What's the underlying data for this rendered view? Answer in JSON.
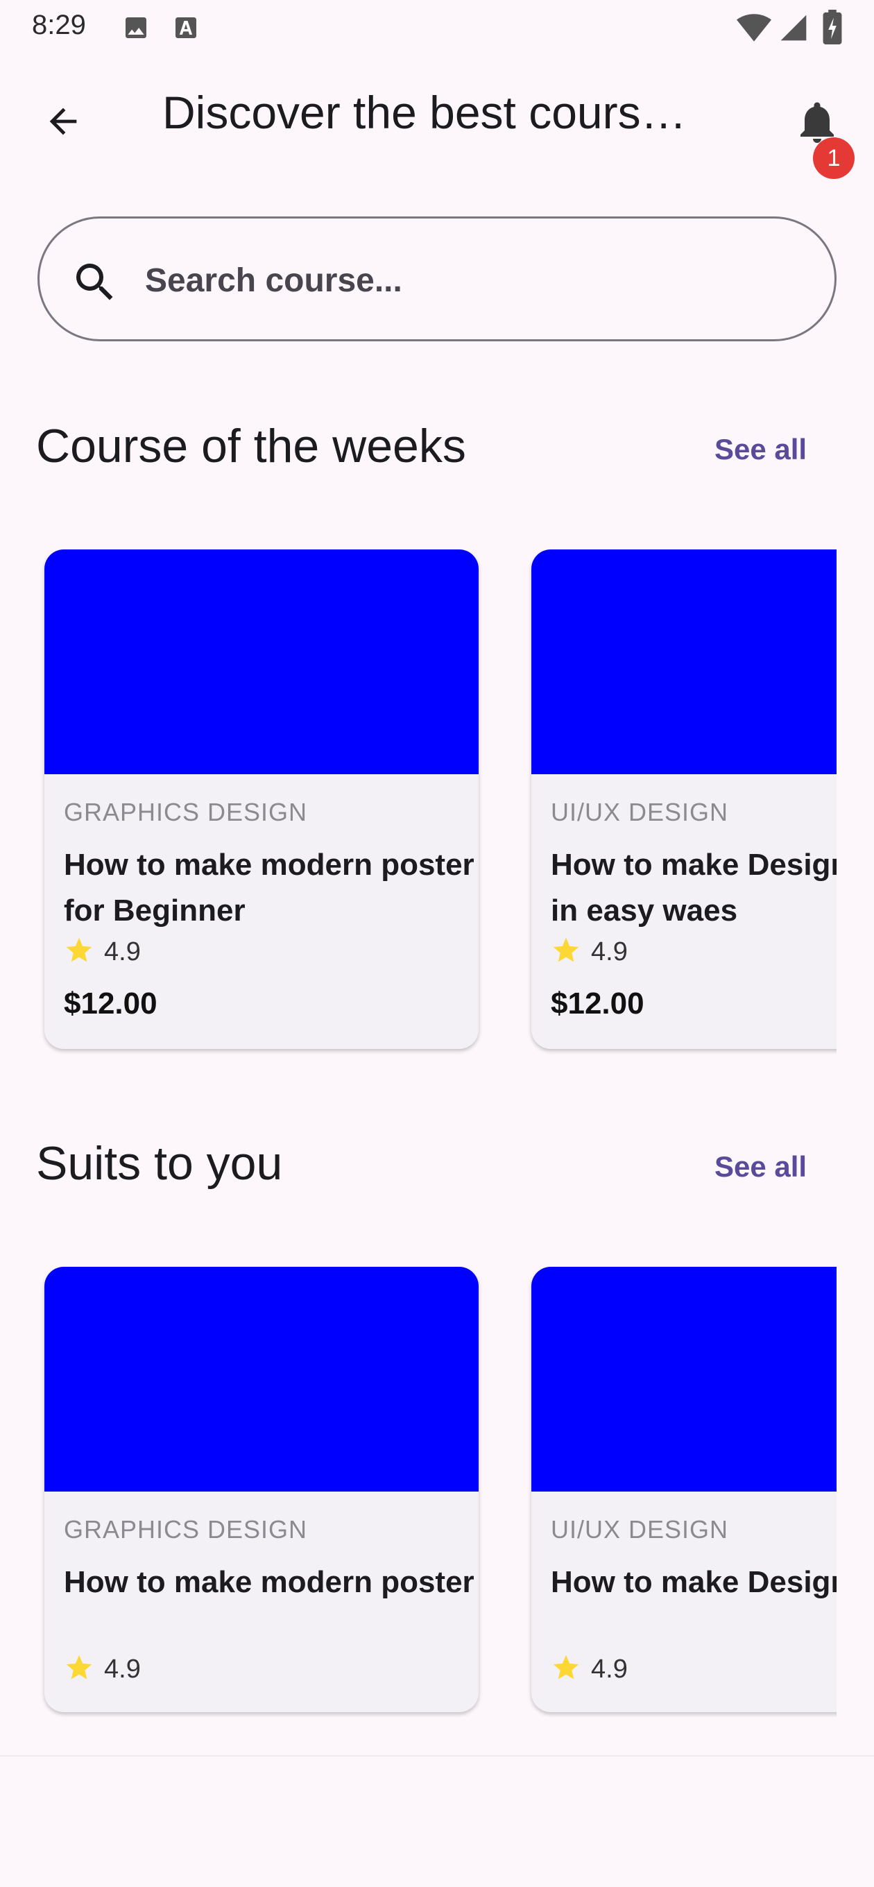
{
  "status_bar": {
    "time": "8:29"
  },
  "app_bar": {
    "title": "Discover the best cours…",
    "notification_count": "1"
  },
  "search": {
    "placeholder": "Search course..."
  },
  "sections": [
    {
      "title": "Course of the weeks",
      "see_all": "See all",
      "cards": [
        {
          "category": "GRAPHICS DESIGN",
          "title": "How to make modern poster for Beginner",
          "rating": "4.9",
          "price": "$12.00",
          "thumb_color": "#0000ff"
        },
        {
          "category": "UI/UX DESIGN",
          "title": "How to make Design system in easy waes",
          "rating": "4.9",
          "price": "$12.00",
          "thumb_color": "#0000ff"
        }
      ]
    },
    {
      "title": "Suits to you",
      "see_all": "See all",
      "cards": [
        {
          "category": "GRAPHICS DESIGN",
          "title": "How to make modern poster",
          "rating": "4.9",
          "thumb_color": "#0000ff"
        },
        {
          "category": "UI/UX DESIGN",
          "title": "How to make Design system",
          "rating": "4.9",
          "thumb_color": "#0000ff"
        }
      ]
    }
  ],
  "colors": {
    "accent": "#5a4b9a",
    "badge": "#e53935",
    "star": "#fdd835",
    "background": "#fdf7fc"
  },
  "icons": [
    "image-icon",
    "text-icon",
    "wifi-icon",
    "signal-icon",
    "battery-icon",
    "back-arrow-icon",
    "bell-icon",
    "search-icon",
    "star-icon"
  ]
}
